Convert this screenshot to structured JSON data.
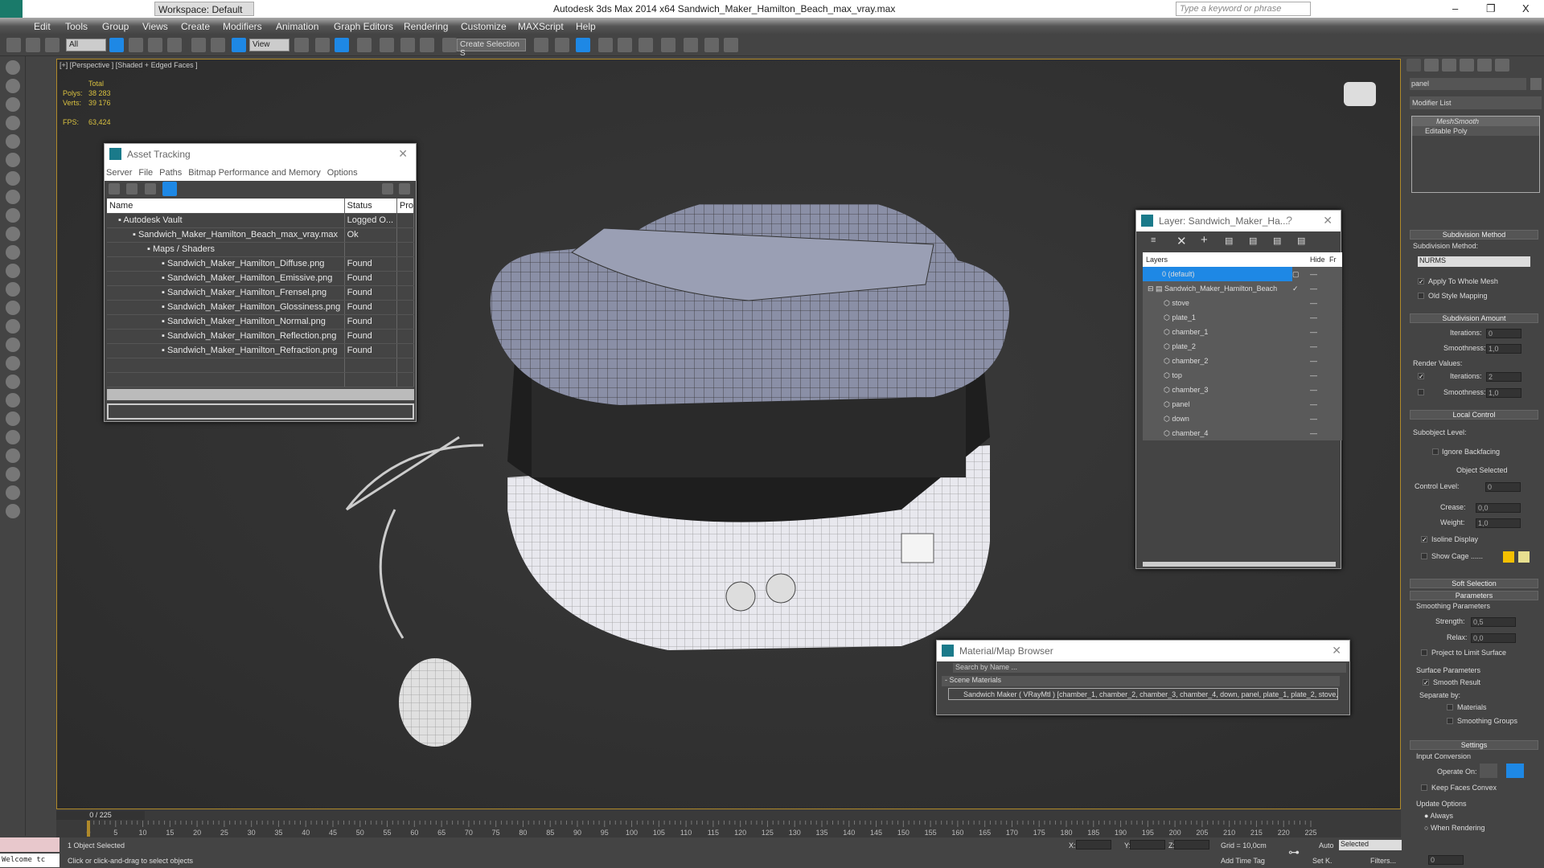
{
  "titlebar": {
    "workspace": "Workspace: Default",
    "title": "Autodesk 3ds Max  2014 x64     Sandwich_Maker_Hamilton_Beach_max_vray.max",
    "search_placeholder": "Type a keyword or phrase",
    "min": "–",
    "max": "❐",
    "close": "X"
  },
  "menu": [
    "Edit",
    "Tools",
    "Group",
    "Views",
    "Create",
    "Modifiers",
    "Animation",
    "Graph Editors",
    "Rendering",
    "Customize",
    "MAXScript",
    "Help"
  ],
  "toolbar": {
    "filter": "All",
    "refcoord": "View",
    "selset": "Create Selection S"
  },
  "viewport": {
    "label": "[+] [Perspective ] [Shaded + Edged Faces ]",
    "total": "Total",
    "polys_label": "Polys:",
    "polys": "38 283",
    "verts_label": "Verts:",
    "verts": "39 176",
    "fps_label": "FPS:",
    "fps": "63,424"
  },
  "asset": {
    "title": "Asset Tracking",
    "menu": [
      "Server",
      "File",
      "Paths",
      "Bitmap Performance and Memory",
      "Options"
    ],
    "cols": [
      "Name",
      "Status",
      "Pro"
    ],
    "rows": [
      {
        "name": "Autodesk Vault",
        "status": "Logged O...",
        "indent": 1
      },
      {
        "name": "Sandwich_Maker_Hamilton_Beach_max_vray.max",
        "status": "Ok",
        "indent": 2
      },
      {
        "name": "Maps / Shaders",
        "status": "",
        "indent": 3
      },
      {
        "name": "Sandwich_Maker_Hamilton_Diffuse.png",
        "status": "Found",
        "indent": 4
      },
      {
        "name": "Sandwich_Maker_Hamilton_Emissive.png",
        "status": "Found",
        "indent": 4
      },
      {
        "name": "Sandwich_Maker_Hamilton_Frensel.png",
        "status": "Found",
        "indent": 4
      },
      {
        "name": "Sandwich_Maker_Hamilton_Glossiness.png",
        "status": "Found",
        "indent": 4
      },
      {
        "name": "Sandwich_Maker_Hamilton_Normal.png",
        "status": "Found",
        "indent": 4
      },
      {
        "name": "Sandwich_Maker_Hamilton_Reflection.png",
        "status": "Found",
        "indent": 4
      },
      {
        "name": "Sandwich_Maker_Hamilton_Refraction.png",
        "status": "Found",
        "indent": 4
      }
    ]
  },
  "layer": {
    "title": "Layer: Sandwich_Maker_Ha...",
    "help": "?",
    "cols": [
      "Layers",
      "Hide",
      "Fr"
    ],
    "default": "0 (default)",
    "group": "Sandwich_Maker_Hamilton_Beach",
    "items": [
      "stove",
      "plate_1",
      "chamber_1",
      "plate_2",
      "chamber_2",
      "top",
      "chamber_3",
      "panel",
      "down",
      "chamber_4"
    ]
  },
  "material": {
    "title": "Material/Map Browser",
    "search_placeholder": "Search by Name ...",
    "section": "- Scene Materials",
    "item": "Sandwich Maker  ( VRayMtl ) [chamber_1, chamber_2, chamber_3, chamber_4, down, panel, plate_1, plate_2, stove, top]"
  },
  "cmd": {
    "object_name": "panel",
    "modifier_list": "Modifier List",
    "stack": [
      "MeshSmooth",
      "Editable Poly"
    ],
    "subdiv_method_title": "Subdivision Method",
    "subdiv_method_label": "Subdivision Method:",
    "subdiv_method": "NURMS",
    "apply_whole": "Apply To Whole Mesh",
    "old_style": "Old Style Mapping",
    "subdiv_amount_title": "Subdivision Amount",
    "iterations_label": "Iterations:",
    "iterations": "0",
    "smoothness_label": "Smoothness:",
    "smoothness": "1,0",
    "render_values": "Render Values:",
    "r_iterations": "2",
    "r_smoothness": "1,0",
    "local_control_title": "Local Control",
    "subobject_level": "Subobject Level:",
    "ignore_backfacing": "Ignore Backfacing",
    "object_selected": "Object Selected",
    "control_level_label": "Control Level:",
    "control_level": "0",
    "crease_label": "Crease:",
    "crease": "0,0",
    "weight_label": "Weight:",
    "weight": "1,0",
    "isoline": "Isoline Display",
    "show_cage": "Show Cage ......",
    "soft_selection_title": "Soft Selection",
    "parameters_title": "Parameters",
    "smoothing_params": "Smoothing Parameters",
    "strength_label": "Strength:",
    "strength": "0,5",
    "relax_label": "Relax:",
    "relax": "0,0",
    "project_limit": "Project to Limit Surface",
    "surface_params": "Surface Parameters",
    "smooth_result": "Smooth Result",
    "separate_by": "Separate by:",
    "materials": "Materials",
    "smoothing_groups": "Smoothing Groups",
    "settings_title": "Settings",
    "input_conversion": "Input Conversion",
    "operate_on": "Operate On:",
    "keep_convex": "Keep Faces Convex",
    "update_options": "Update Options",
    "always": "Always",
    "when_rendering": "When Rendering",
    "cage_colors": [
      "#f5c000",
      "#e8e090"
    ]
  },
  "timeline": {
    "frame": "0 / 225",
    "ticks": [
      0,
      5,
      10,
      15,
      20,
      25,
      30,
      35,
      40,
      45,
      50,
      55,
      60,
      65,
      70,
      75,
      80,
      85,
      90,
      95,
      100,
      105,
      110,
      115,
      120,
      125,
      130,
      135,
      140,
      145,
      150,
      155,
      160,
      165,
      170,
      175,
      180,
      185,
      190,
      195,
      200,
      205,
      210,
      215,
      220,
      225
    ]
  },
  "status": {
    "welcome": "Welcome tc",
    "selected": "1 Object Selected",
    "prompt": "Click or click-and-drag to select objects",
    "x": "X:",
    "y": "Y:",
    "z": "Z:",
    "grid": "Grid = 10,0cm",
    "add_time_tag": "Add Time Tag",
    "auto": "Auto",
    "setk": "Set K.",
    "key_filter": "Selected",
    "filters": "Filters...",
    "frame_value": "0"
  },
  "colors": {
    "accent": "#1e88e5",
    "viewport_border": "#b08a2a",
    "stats": "#d8c040"
  }
}
